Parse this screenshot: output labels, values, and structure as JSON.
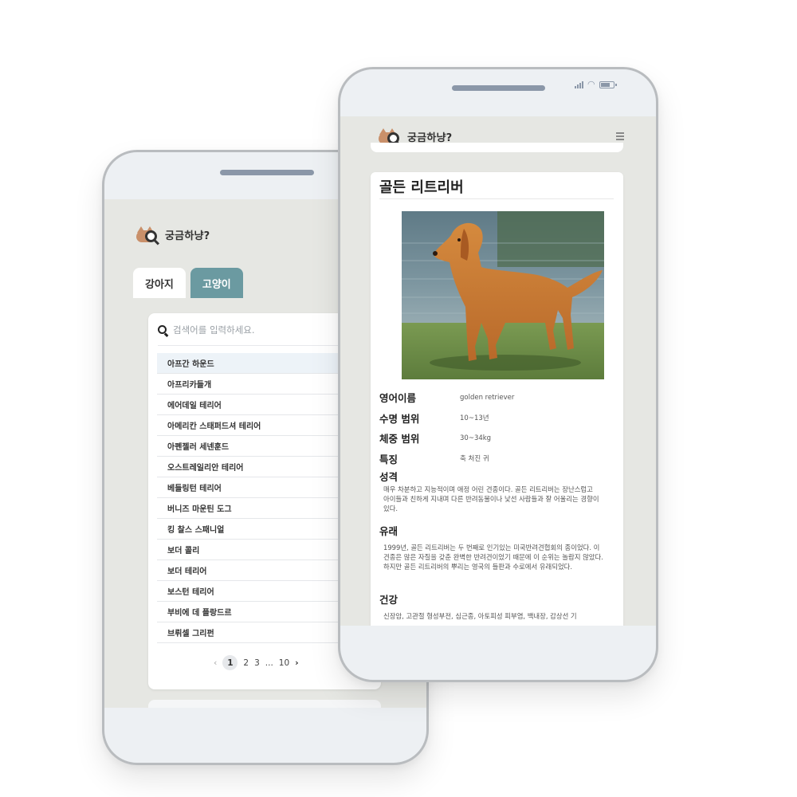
{
  "app": {
    "name": "궁금하냥?"
  },
  "left_phone": {
    "tabs": [
      {
        "label": "강아지",
        "active": true
      },
      {
        "label": "고양이",
        "active": false
      }
    ],
    "search_placeholder": "검색어를 입력하세요.",
    "breeds": [
      "아프간 하운드",
      "아프리카들개",
      "에어데일 테리어",
      "아메리칸 스태퍼드셔 테리어",
      "아펜젤러 세넨훈드",
      "오스트레일리안 테리어",
      "베들링턴 테리어",
      "버니즈 마운틴 도그",
      "킹 찰스 스패니얼",
      "보더 콜리",
      "보더 테리어",
      "보스턴 테리어",
      "부비에 데 플랑드르",
      "브뤼셀 그리펀"
    ],
    "pagination": {
      "prev": "‹",
      "pages": [
        "1",
        "2",
        "3"
      ],
      "ellipsis": "...",
      "last": "10",
      "next": "›",
      "current": "1"
    }
  },
  "right_phone": {
    "breed_title": "골든 리트리버",
    "facts": [
      {
        "label": "영어이름",
        "value": "golden retriever"
      },
      {
        "label": "수명 범위",
        "value": "10~13년"
      },
      {
        "label": "체중 범위",
        "value": "30~34kg"
      },
      {
        "label": "특징",
        "value": "축 처진 귀"
      }
    ],
    "sections": [
      {
        "heading": "성격",
        "text": "매우 차분하고 지능적이며 애정 어린 견종이다. 골든 리트리버는 장난스럽고 아이들과 친하게 지내며 다른 반려동물이나 낯선 사람들과 잘 어울리는 경향이 있다."
      },
      {
        "heading": "유래",
        "text": "1999년, 골든 리트리버는 두 번째로 인기있는 미국반려견협회의 종이었다. 이 견종은 많은 자질을 갖춘 완벽한 반려견이었기 때문에 이 순위는 놀랍지 않았다. 하지만 골든 리트리버의 뿌리는 영국의 들판과 수로에서 유래되었다."
      },
      {
        "heading": "건강",
        "text": "신장암, 고관절 형성부전, 심근종, 아토피성 피부염, 백내장, 갑상선 기"
      }
    ]
  },
  "colors": {
    "accent_tab": "#6b9aa1",
    "screen_bg": "#e6e7e3",
    "frame": "#b9bcbf",
    "speaker": "#8b97a8"
  }
}
